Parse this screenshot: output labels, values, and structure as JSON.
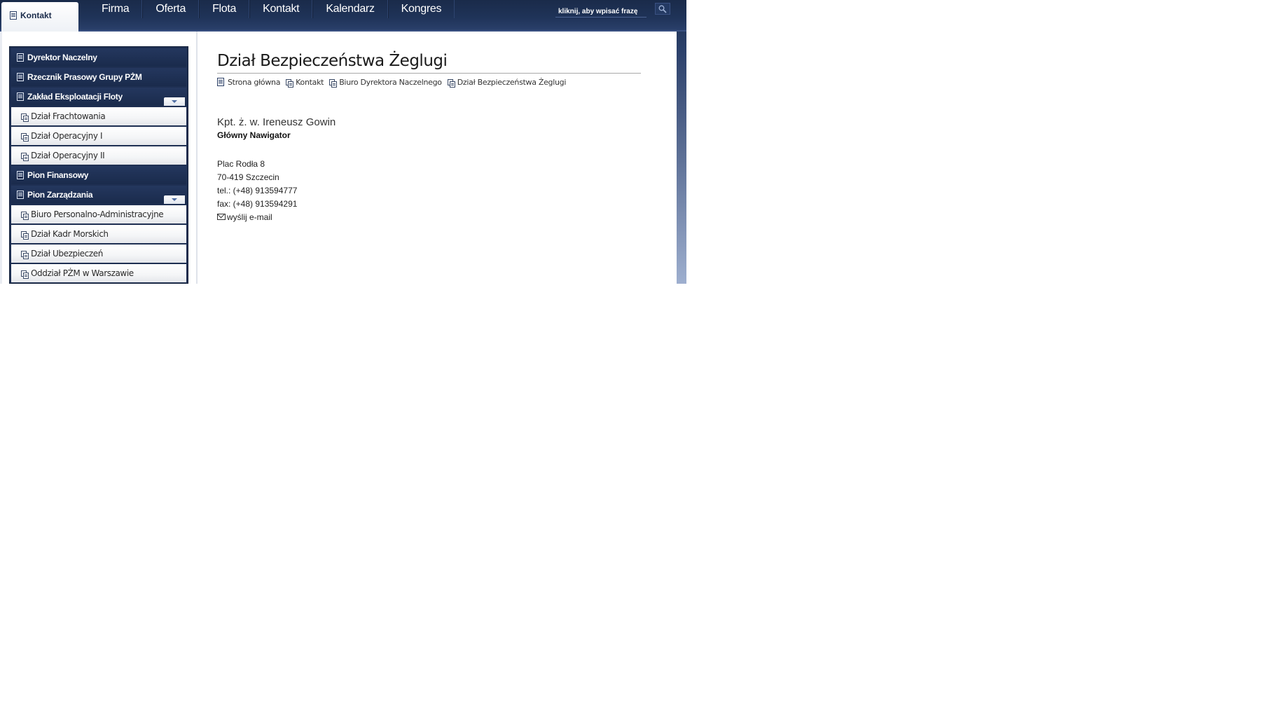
{
  "header": {
    "current_tab": "Kontakt",
    "nav": [
      "Firma",
      "Oferta",
      "Flota",
      "Kontakt",
      "Kalendarz",
      "Kongres"
    ],
    "search_placeholder": "kliknij, aby wpisać frazę"
  },
  "sidebar": {
    "items": [
      {
        "label": "Dyrektor Naczelny",
        "level": "main",
        "expandable": false
      },
      {
        "label": "Rzecznik Prasowy Grupy PŻM",
        "level": "main",
        "expandable": false
      },
      {
        "label": "Zakład Eksploatacji Floty",
        "level": "main",
        "expandable": true
      },
      {
        "label": "Dział Frachtowania",
        "level": "sub"
      },
      {
        "label": "Dział Operacyjny I",
        "level": "sub"
      },
      {
        "label": "Dział Operacyjny II",
        "level": "sub"
      },
      {
        "label": "Pion Finansowy",
        "level": "main",
        "expandable": false
      },
      {
        "label": "Pion Zarządzania",
        "level": "main",
        "expandable": true
      },
      {
        "label": "Biuro Personalno-Administracyjne",
        "level": "sub"
      },
      {
        "label": "Dział Kadr Morskich",
        "level": "sub"
      },
      {
        "label": "Dział Ubezpieczeń",
        "level": "sub"
      },
      {
        "label": "Oddział PŻM w Warszawie",
        "level": "sub"
      }
    ]
  },
  "main": {
    "title": "Dział Bezpieczeństwa Żeglugi",
    "breadcrumb": [
      "Strona główna",
      "Kontakt",
      "Biuro Dyrektora Naczelnego",
      "Dział Bezpieczeństwa Żeglugi"
    ],
    "person": {
      "name": "Kpt. ż. w. Ireneusz Gowin",
      "role": "Główny Nawigator",
      "address_line1": "Plac Rodła 8",
      "address_line2": "70-419 Szczecin",
      "phone": "tel.: (+48) 913594777",
      "fax": "fax: (+48) 913594291",
      "email_link": "wyślij e-mail"
    }
  },
  "colors": {
    "nav_bg": "#1f3358",
    "sidebar_main_bg": "#1e2f52",
    "page_bg_gradient_end": "#9eafcf"
  }
}
